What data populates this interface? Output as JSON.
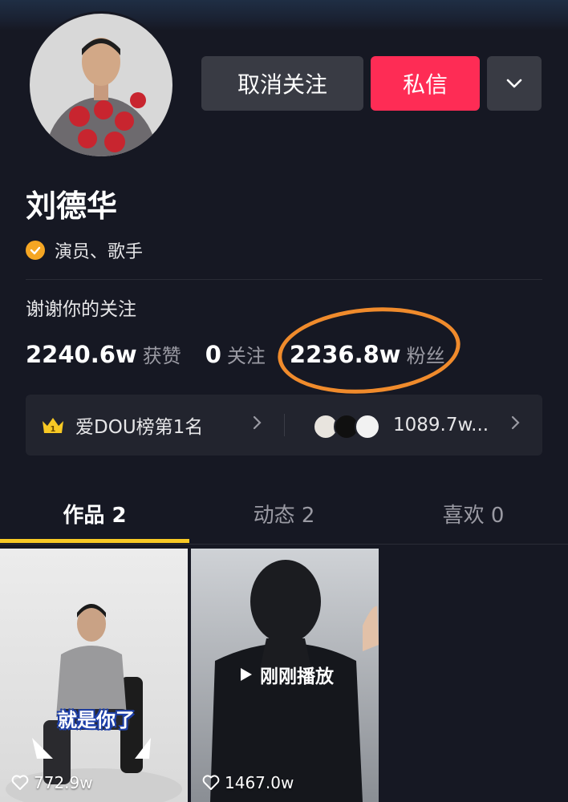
{
  "profile": {
    "name": "刘德华",
    "verification": "演员、歌手",
    "bio": "谢谢你的关注"
  },
  "actions": {
    "unfollow_label": "取消关注",
    "message_label": "私信",
    "more_icon": "chevron-down-icon"
  },
  "stats": {
    "likes_value": "2240.6w",
    "likes_label": "获赞",
    "following_value": "0",
    "following_label": "关注",
    "followers_value": "2236.8w",
    "followers_label": "粉丝"
  },
  "rank": {
    "label": "爱DOU榜第1名",
    "fans_count": "1089.7w..."
  },
  "tabs": [
    {
      "label": "作品 2"
    },
    {
      "label": "动态 2"
    },
    {
      "label": "喜欢 0"
    }
  ],
  "videos": [
    {
      "caption": "就是你了",
      "likes": "772.9w"
    },
    {
      "badge": "刚刚播放",
      "likes": "1467.0w"
    }
  ],
  "colors": {
    "background": "#161823",
    "accent": "#fe2c55",
    "tab_indicator": "#f8c924",
    "annotation": "#f08b2c"
  }
}
